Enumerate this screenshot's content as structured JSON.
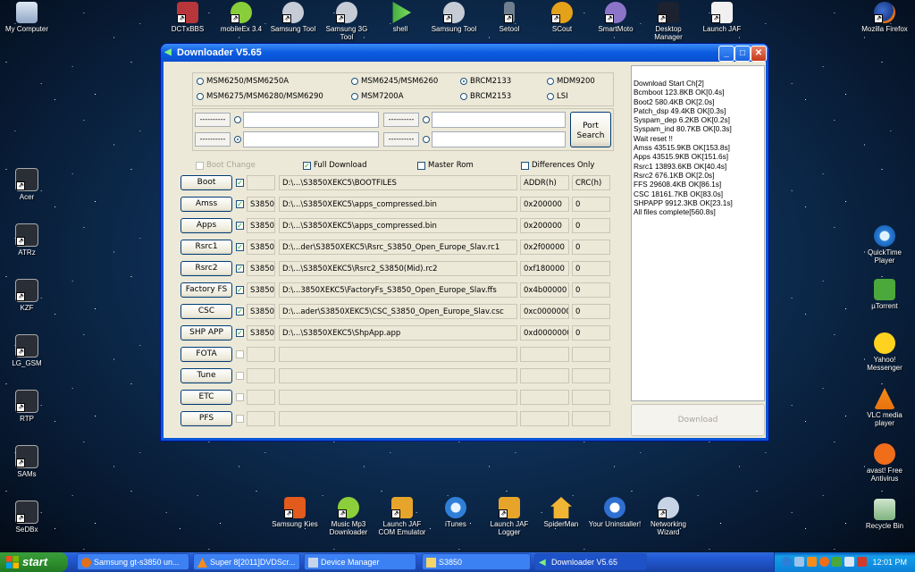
{
  "desktop": {
    "top_icons": [
      "My Computer",
      "DCTxBBS",
      "mobileEx 3.4",
      "Samsung Tool",
      "Samsung 3G Tool",
      "shell",
      "Samsung Tool",
      "Setool",
      "SCout",
      "SmartMoto",
      "Desktop Manager",
      "Launch JAF",
      "Mozilla Firefox"
    ],
    "left_icons": [
      "Acer",
      "ATRz",
      "KZF",
      "LG_GSM",
      "RTP",
      "SAMs",
      "SeDBx"
    ],
    "right_icons": [
      "QuickTime Player",
      "µTorrent",
      "Yahoo! Messenger",
      "VLC media player",
      "avast! Free Antivirus",
      "Recycle Bin"
    ],
    "bottom_icons": [
      "Samsung Kies",
      "Music Mp3 Downloader",
      "Launch JAF COM Emulator",
      "iTunes",
      "Launch JAF Logger",
      "SpiderMan",
      "Your Uninstaller!",
      "Networking Wizard"
    ]
  },
  "window": {
    "title": "Downloader V5.65",
    "controls": {
      "minimize": "_",
      "maximize": "□",
      "close": "✕"
    },
    "chipsets": [
      {
        "label": "MSM6250/MSM6250A",
        "selected": false
      },
      {
        "label": "MSM6245/MSM6260",
        "selected": false
      },
      {
        "label": "BRCM2133",
        "selected": true
      },
      {
        "label": "MDM9200",
        "selected": false
      },
      {
        "label": "MSM6275/MSM6280/MSM6290",
        "selected": false
      },
      {
        "label": "MSM7200A",
        "selected": false
      },
      {
        "label": "BRCM2153",
        "selected": false
      },
      {
        "label": "LSI",
        "selected": false
      }
    ],
    "port_buttons": [
      "----------",
      "----------",
      "----------",
      "----------"
    ],
    "port_search_label": "Port Search",
    "options": [
      {
        "label": "Boot Change",
        "checked": false,
        "enabled": false
      },
      {
        "label": "Full Download",
        "checked": true,
        "enabled": true
      },
      {
        "label": "Master Rom",
        "checked": false,
        "enabled": true
      },
      {
        "label": "Differences Only",
        "checked": false,
        "enabled": true
      }
    ],
    "rows": [
      {
        "button": "Boot",
        "checked": true,
        "model": "",
        "path": "D:\\...\\S3850XEKC5\\BOOTFILES",
        "addr": "ADDR(h)",
        "crc": "CRC(h)"
      },
      {
        "button": "Amss",
        "checked": true,
        "model": "S3850",
        "path": "D:\\...\\S3850XEKC5\\apps_compressed.bin",
        "addr": "0x200000",
        "crc": "0"
      },
      {
        "button": "Apps",
        "checked": true,
        "model": "S3850",
        "path": "D:\\...\\S3850XEKC5\\apps_compressed.bin",
        "addr": "0x200000",
        "crc": "0"
      },
      {
        "button": "Rsrc1",
        "checked": true,
        "model": "S3850",
        "path": "D:\\...der\\S3850XEKC5\\Rsrc_S3850_Open_Europe_Slav.rc1",
        "addr": "0x2f00000",
        "crc": "0"
      },
      {
        "button": "Rsrc2",
        "checked": true,
        "model": "S3850",
        "path": "D:\\...\\S3850XEKC5\\Rsrc2_S3850(Mid).rc2",
        "addr": "0xf180000",
        "crc": "0"
      },
      {
        "button": "Factory FS",
        "checked": true,
        "model": "S3850",
        "path": "D:\\...3850XEKC5\\FactoryFs_S3850_Open_Europe_Slav.ffs",
        "addr": "0x4b00000",
        "crc": "0"
      },
      {
        "button": "CSC",
        "checked": true,
        "model": "S3850",
        "path": "D:\\...ader\\S3850XEKC5\\CSC_S3850_Open_Europe_Slav.csc",
        "addr": "0xc0000000",
        "crc": "0"
      },
      {
        "button": "SHP APP",
        "checked": true,
        "model": "S3850",
        "path": "D:\\...\\S3850XEKC5\\ShpApp.app",
        "addr": "0xd0000000",
        "crc": "0"
      },
      {
        "button": "FOTA",
        "checked": false,
        "model": "",
        "path": "",
        "addr": "",
        "crc": ""
      },
      {
        "button": "Tune",
        "checked": false,
        "model": "",
        "path": "",
        "addr": "",
        "crc": ""
      },
      {
        "button": "ETC",
        "checked": false,
        "model": "",
        "path": "",
        "addr": "",
        "crc": ""
      },
      {
        "button": "PFS",
        "checked": false,
        "model": "",
        "path": "",
        "addr": "",
        "crc": ""
      }
    ],
    "log_lines": [
      "Download Start Ch[2]",
      "Bcmboot 123.8KB OK[0.4s]",
      "Boot2 580.4KB OK[2.0s]",
      "Patch_dsp 49.4KB OK[0.3s]",
      "Syspam_dep 6.2KB OK[0.2s]",
      "Syspam_ind 80.7KB OK[0.3s]",
      "Wait reset !!",
      "Amss 43515.9KB OK[153.8s]",
      "Apps 43515.9KB OK[151.6s]",
      "Rsrc1 13893.6KB OK[40.4s]",
      "Rsrc2 676.1KB OK[2.0s]",
      "FFS 29608.4KB OK[86.1s]",
      "CSC 18161.7KB OK[83.0s]",
      "SHPAPP 9912.3KB OK[23.1s]",
      "All files complete[560.8s]"
    ],
    "download_label": "Download"
  },
  "taskbar": {
    "start_label": "start",
    "tasks": [
      {
        "label": "Samsung gt-s3850 un...",
        "active": false
      },
      {
        "label": "Super 8[2011]DVDScr...",
        "active": false
      },
      {
        "label": "Device Manager",
        "active": false
      },
      {
        "label": "S3850",
        "active": false
      },
      {
        "label": "Downloader V5.65",
        "active": true
      }
    ],
    "clock": "12:01 PM"
  },
  "colors": {
    "xp_blue": "#0a55d8",
    "start_green": "#2f8f2f",
    "window_bg": "#ece9d8"
  }
}
